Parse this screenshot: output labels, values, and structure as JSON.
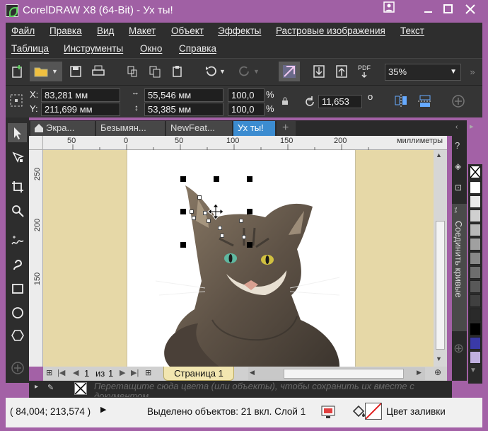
{
  "window": {
    "title": "CorelDRAW X8 (64-Bit) - Ух ты!"
  },
  "menu": {
    "row1": [
      "Файл",
      "Правка",
      "Вид",
      "Макет",
      "Объект",
      "Эффекты",
      "Растровые изображения",
      "Текст"
    ],
    "row2": [
      "Таблица",
      "Инструменты",
      "Окно",
      "Справка"
    ]
  },
  "toolbar": {
    "zoom": "35%",
    "pdf_label": "PDF"
  },
  "property_bar": {
    "x_label": "X:",
    "x_value": "83,281 мм",
    "y_label": "Y:",
    "y_value": "211,699 мм",
    "width_value": "55,546 мм",
    "height_value": "53,385 мм",
    "scale_x": "100,0",
    "scale_y": "100,0",
    "percent": "%",
    "rotation": "11,653",
    "degree": "o"
  },
  "tabs": [
    "Экра...",
    "Безымян...",
    "NewFeat...",
    "Ух ты!"
  ],
  "active_tab": "Ух ты!",
  "ruler": {
    "h_ticks": [
      "50",
      "0",
      "50",
      "100",
      "150",
      "200"
    ],
    "units": "миллиметры",
    "v_ticks": [
      "250",
      "200",
      "150"
    ]
  },
  "page_nav": {
    "current": "1",
    "of_label": "из",
    "total": "1",
    "page_tab": "Страница 1"
  },
  "hint": "Перетащите сюда цвета (или объекты), чтобы сохранить их вместе с документом",
  "docker": {
    "label": "Соединить кривые"
  },
  "palette_colors": [
    "#ffffff",
    "#e8e8e8",
    "#d0d0d0",
    "#b8b8b8",
    "#a0a0a0",
    "#888888",
    "#6e6e6e",
    "#585858",
    "#404040",
    "#2a2a2a",
    "#000000",
    "#3a3aa8",
    "#c0b0e0"
  ],
  "status": {
    "coords": "( 84,004; 213,574 )",
    "selection": "Выделено объектов: 21 вкл. Слой 1",
    "fill_label": "Цвет заливки"
  },
  "icons": [
    "cursor-icon",
    "shape-icon",
    "crop-icon",
    "zoom-icon",
    "freehand-icon",
    "artistic-media-icon",
    "rectangle-icon",
    "ellipse-icon",
    "polygon-icon"
  ]
}
